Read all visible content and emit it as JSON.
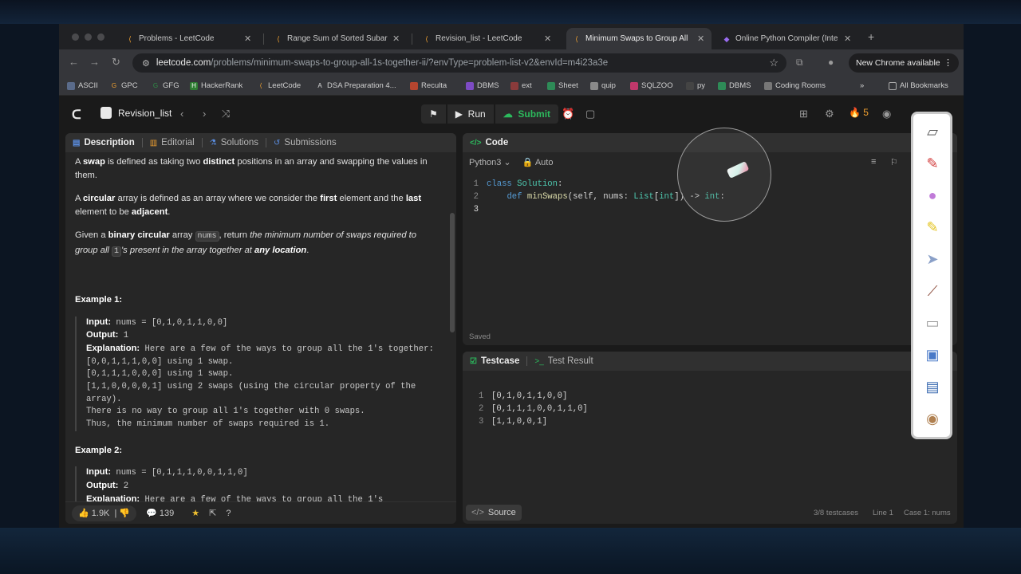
{
  "browser": {
    "tabs": [
      {
        "title": "Problems - LeetCode",
        "active": false
      },
      {
        "title": "Range Sum of Sorted Subarra",
        "active": false
      },
      {
        "title": "Revision_list - LeetCode",
        "active": false
      },
      {
        "title": "Minimum Swaps to Group All",
        "active": true
      },
      {
        "title": "Online Python Compiler (Inte",
        "active": false
      }
    ],
    "url_host": "leetcode.com",
    "url_path": "/problems/minimum-swaps-to-group-all-1s-together-ii/?envType=problem-list-v2&envId=m4i23a3e",
    "update_label": "New Chrome available",
    "bookmarks": [
      "ASCII",
      "GPC",
      "GFG",
      "HackerRank",
      "LeetCode",
      "DSA Preparation 4...",
      "Reculta",
      "DBMS",
      "ext",
      "Sheet",
      "quip",
      "SQLZOO",
      "py",
      "DBMS",
      "Coding Rooms"
    ],
    "all_bookmarks": "All Bookmarks"
  },
  "header": {
    "list_name": "Revision_list",
    "run_label": "Run",
    "submit_label": "Submit",
    "streak": "5"
  },
  "left_panel": {
    "tabs": [
      "Description",
      "Editorial",
      "Solutions",
      "Submissions"
    ],
    "footer": {
      "likes": "1.9K",
      "comments": "139"
    }
  },
  "description": {
    "p1_a": " is defined as taking two ",
    "p1_b": "swap",
    "p1_c": "distinct",
    "p1_d": " positions in an array and swapping the values in them.",
    "p2_a": "A ",
    "p2_b": "circular",
    "p2_c": " array is defined as an array where we consider the ",
    "p2_d": "first",
    "p2_e": " element and the ",
    "p2_f": "last",
    "p2_g": " element to be ",
    "p2_h": "adjacent",
    "p3_a": "Given a ",
    "p3_b": "binary circular",
    "p3_c": " array ",
    "p3_code": "nums",
    "p3_d": ", return ",
    "p3_e": "the minimum number of swaps required to group all ",
    "p3_code2": "1",
    "p3_f": "'s present in the array together at ",
    "p3_g": "any location",
    "example1_title": "Example 1:",
    "example1_input": "nums = [0,1,0,1,1,0,0]",
    "example1_output": "1",
    "example1_explanation": "Here are a few of the ways to group all the 1's together:\n[0,0,1,1,1,0,0] using 1 swap.\n[0,1,1,1,0,0,0] using 1 swap.\n[1,1,0,0,0,0,1] using 2 swaps (using the circular property of the array).\nThere is no way to group all 1's together with 0 swaps.\nThus, the minimum number of swaps required is 1.",
    "example2_title": "Example 2:",
    "example2_input": "nums = [0,1,1,1,0,0,1,1,0]",
    "example2_output": "2",
    "example2_explanation": "Here are a few of the ways to group all the 1's",
    "input_label": "Input:",
    "output_label": "Output:",
    "explanation_label": "Explanation:"
  },
  "code_panel": {
    "tab_label": "Code",
    "language": "Python3",
    "mode": "Auto",
    "lines": [
      "class Solution:",
      "    def minSwaps(self, nums: List[int]) -> int:",
      ""
    ],
    "saved": "Saved"
  },
  "testcase_panel": {
    "tabs": [
      "Testcase",
      "Test Result"
    ],
    "cases": [
      "[0,1,0,1,1,0,0]",
      "[0,1,1,1,0,0,1,1,0]",
      "[1,1,0,0,1]"
    ],
    "source_label": "Source",
    "testcases_count": "3/8 testcases",
    "line": "Line 1",
    "case": "Case 1: nums"
  },
  "colors": {
    "accent_green": "#2cbb5d",
    "streak_orange": "#f0a030",
    "link_blue": "#5a8de0"
  }
}
